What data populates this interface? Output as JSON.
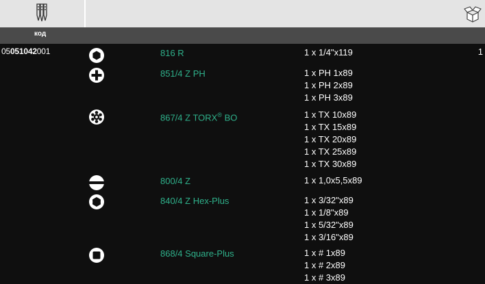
{
  "header": {
    "column_label": "код",
    "icons": {
      "left": "screwdriver-bits-icon",
      "right": "open-box-icon"
    }
  },
  "article": {
    "prefix": "05",
    "bold": "051042",
    "suffix": "001",
    "quantity": "1"
  },
  "rows": [
    {
      "icon": "hex-profile-icon",
      "name": "816 R",
      "items": [
        "1 x 1/4\"x119"
      ]
    },
    {
      "icon": "phillips-profile-icon",
      "name": "851/4 Z PH",
      "items": [
        "1 x PH 1x89",
        "1 x PH 2x89",
        "1 x PH 3x89"
      ]
    },
    {
      "icon": "torx-profile-icon",
      "name": "867/4 Z TORX",
      "name_sup": "®",
      "name_tail": " BO",
      "items": [
        "1 x TX 10x89",
        "1 x TX 15x89",
        "1 x TX 20x89",
        "1 x TX 25x89",
        "1 x TX 30x89"
      ]
    },
    {
      "icon": "slotted-profile-icon",
      "name": "800/4 Z",
      "items": [
        "1 x 1,0x5,5x89"
      ]
    },
    {
      "icon": "hex-plus-profile-icon",
      "name": "840/4 Z Hex-Plus",
      "items": [
        "1 x 3/32\"x89",
        "1 x 1/8\"x89",
        "1 x 5/32\"x89",
        "1 x 3/16\"x89"
      ]
    },
    {
      "icon": "square-profile-icon",
      "name": "868/4 Square-Plus",
      "items": [
        "1 x # 1x89",
        "1 x # 2x89",
        "1 x # 3x89"
      ]
    }
  ]
}
